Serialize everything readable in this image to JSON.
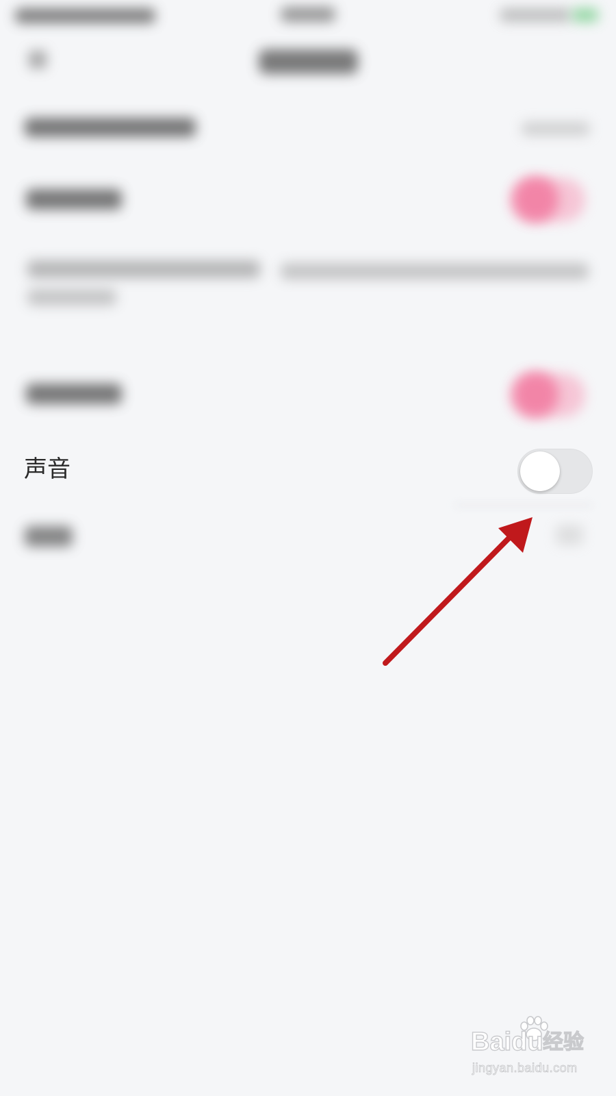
{
  "settings": {
    "sound_label": "声音",
    "sound_toggle_on": false
  },
  "watermark": {
    "brand": "Baidu",
    "product": "经验",
    "url": "jingyan.baidu.com"
  },
  "colors": {
    "background": "#f5f6f8",
    "toggle_off_track": "#e5e6e8",
    "toggle_on_blurred": "#f27aa0",
    "annotation_arrow": "#c0191c"
  },
  "icons": {
    "annotation": "red-arrow-icon",
    "watermark_logo": "paw-icon"
  }
}
